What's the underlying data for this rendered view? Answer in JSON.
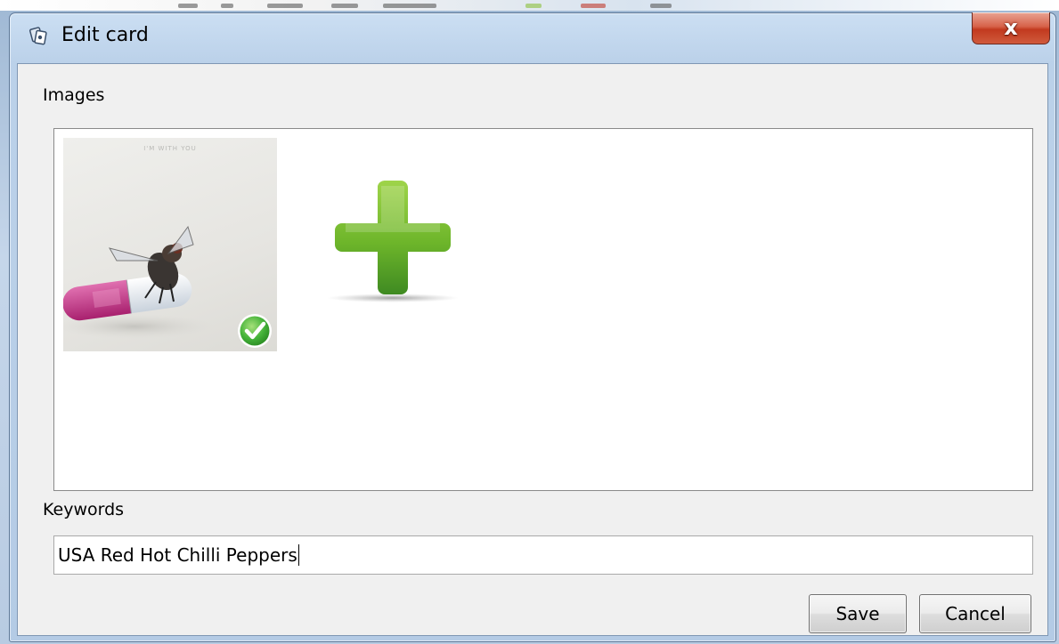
{
  "window": {
    "title": "Edit card",
    "close_symbol": "x",
    "title_icon": "cards-icon"
  },
  "images_section": {
    "label": "Images",
    "thumbnail": {
      "caption": "I'M WITH YOU",
      "selected": true,
      "badge_icon": "check-icon"
    },
    "add_icon": "add-plus-icon"
  },
  "keywords_section": {
    "label": "Keywords",
    "value": "USA Red Hot Chilli Peppers"
  },
  "buttons": {
    "save": "Save",
    "cancel": "Cancel"
  },
  "colors": {
    "add_icon_green": "#6db52a",
    "check_green": "#45b33a",
    "close_red": "#c9452a"
  }
}
